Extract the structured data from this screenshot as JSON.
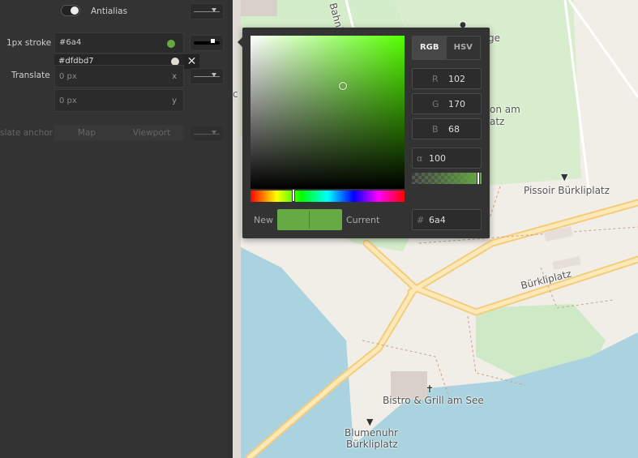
{
  "panel": {
    "antialias_label": "Antialias",
    "stroke_label": "1px stroke",
    "stroke_value": "#6a4",
    "stroke_swatch_color": "#66aa44",
    "alt_color_value": "#dfdbd7",
    "translate_label": "Translate",
    "translate_x_placeholder": "0 px",
    "translate_x_unit": "x",
    "translate_y_placeholder": "0 px",
    "translate_y_unit": "y",
    "anchor_label": "slate anchor",
    "anchor_map": "Map",
    "anchor_viewport": "Viewport"
  },
  "picker": {
    "tabs": [
      "RGB",
      "HSV"
    ],
    "active_tab": "RGB",
    "channels": [
      {
        "key": "R",
        "value": "102"
      },
      {
        "key": "G",
        "value": "170"
      },
      {
        "key": "B",
        "value": "68"
      }
    ],
    "alpha_key": "α",
    "alpha_value": "100",
    "hex_key": "#",
    "hex_value": "6a4",
    "new_label": "New",
    "current_label": "Current",
    "color": "#66aa44"
  },
  "map": {
    "labels": {
      "bahnhof": "Bahnh",
      "ge": "ge",
      "on_am": "on am",
      "atz": "atz",
      "c": "c",
      "pissoir": "Pissoir Bürkliplatz",
      "buerkliplatz": "Bürkliplatz",
      "bistro": "Bistro & Grill am See",
      "blumenuhr1": "Blumenuhr",
      "blumenuhr2": "Bürkliplatz"
    },
    "water_color": "#aad3df",
    "park_color": "#cde9c5",
    "road_color": "#fcd68a"
  }
}
